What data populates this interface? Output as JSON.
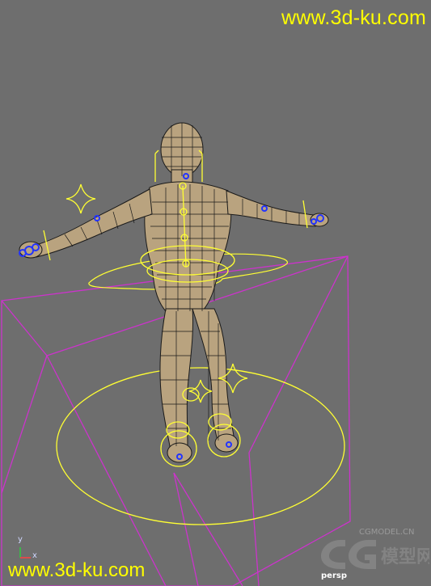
{
  "viewport": {
    "watermark_top": "www.3d-ku.com",
    "watermark_bottom": "www.3d-ku.com",
    "camera_label": "persp",
    "axis_y_label": "y",
    "axis_x_label": "x",
    "watermark_logo_text": "CGMODEL.CN",
    "colors": {
      "background": "#6e6e6e",
      "mesh_fill": "#b9a37f",
      "wireframe": "#1a1a1a",
      "controls": "#ffff33",
      "camera_frustum": "#cc33cc",
      "joints": "#2233ff"
    }
  }
}
